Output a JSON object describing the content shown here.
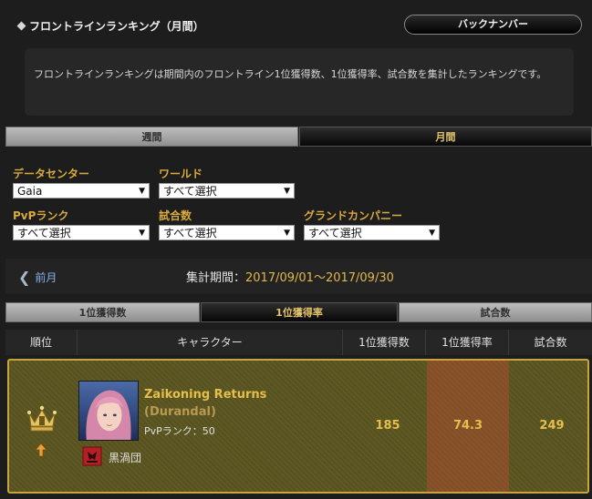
{
  "header": {
    "title": "フロントラインランキング（月間）",
    "back_number_label": "バックナンバー"
  },
  "description": "フロントラインランキングは期間内のフロントライン1位獲得数、1位獲得率、試合数を集計したランキングです。",
  "period_tabs": [
    {
      "label": "週間",
      "active": false
    },
    {
      "label": "月間",
      "active": true
    }
  ],
  "filters": {
    "datacenter": {
      "label": "データセンター",
      "value": "Gaia"
    },
    "world": {
      "label": "ワールド",
      "value": "すべて選択"
    },
    "pvp_rank": {
      "label": "PvPランク",
      "value": "すべて選択"
    },
    "matches": {
      "label": "試合数",
      "value": "すべて選択"
    },
    "grand_company": {
      "label": "グランドカンパニー",
      "value": "すべて選択"
    }
  },
  "period": {
    "prev_label": "前月",
    "label": "集計期間：",
    "value": "2017/09/01～2017/09/30"
  },
  "sort_tabs": [
    {
      "label": "1位獲得数",
      "active": false
    },
    {
      "label": "1位獲得率",
      "active": true
    },
    {
      "label": "試合数",
      "active": false
    }
  ],
  "table": {
    "headers": [
      "順位",
      "キャラクター",
      "1位獲得数",
      "1位獲得率",
      "試合数"
    ],
    "rows": [
      {
        "rank_icon": "crown-rank-1-icon",
        "trend_icon": "up-arrow-icon",
        "name": "Zaikoning Returns",
        "world": "(Durandal)",
        "pvp_rank": "PvPランク：50",
        "grand_company": "黒渦団",
        "wins": "185",
        "win_rate": "74.3",
        "matches": "249"
      }
    ]
  },
  "colors": {
    "accent_gold": "#e4bf4c",
    "label_orange": "#d9a93c",
    "link_blue": "#86b1e4"
  }
}
